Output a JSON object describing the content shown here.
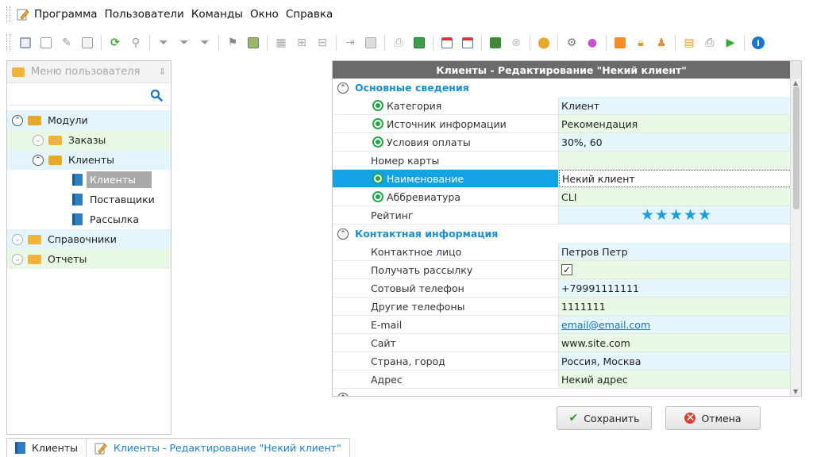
{
  "menubar": {
    "items": [
      "Программа",
      "Пользователи",
      "Команды",
      "Окно",
      "Справка"
    ]
  },
  "toolbar": {
    "icons": [
      "save-icon",
      "copy-icon",
      "edit-icon",
      "export-icon",
      "refresh-icon",
      "search-icon",
      "filter-icon",
      "filter-clear-icon",
      "filter-edit-icon",
      "flag-icon",
      "image-icon",
      "grid-icon",
      "expand-icon",
      "collapse-icon",
      "insert-column-icon",
      "note-icon",
      "print-preview-icon",
      "excel-icon",
      "add-window-icon",
      "close-window-icon",
      "exit-icon",
      "stop-icon",
      "location-icon",
      "settings-icon",
      "color-icon",
      "rss-icon",
      "lock-icon",
      "users-icon",
      "table-icon",
      "print-icon",
      "play-icon",
      "info-icon"
    ]
  },
  "left_panel": {
    "title": "Меню пользователя",
    "tree": [
      {
        "label": "Модули",
        "level": 0,
        "expanded": true
      },
      {
        "label": "Заказы",
        "level": 1,
        "expanded": false
      },
      {
        "label": "Клиенты",
        "level": 1,
        "expanded": true
      },
      {
        "label": "Клиенты",
        "level": 2,
        "selected": true
      },
      {
        "label": "Поставщики",
        "level": 2
      },
      {
        "label": "Рассылка",
        "level": 2
      },
      {
        "label": "Справочники",
        "level": 0,
        "expanded": false
      },
      {
        "label": "Отчеты",
        "level": 0,
        "expanded": false
      }
    ]
  },
  "editor": {
    "title": "Клиенты - Редактирование \"Некий клиент\"",
    "sections": [
      {
        "title": "Основные сведения",
        "rows": [
          {
            "name": "Категория",
            "value": "Клиент",
            "required": true
          },
          {
            "name": "Источник информации",
            "value": "Рекомендация",
            "required": true
          },
          {
            "name": "Условия оплаты",
            "value": "30%, 60",
            "required": true
          },
          {
            "name": "Номер карты",
            "value": "",
            "required": false
          },
          {
            "name": "Наименование",
            "value": "Некий клиент",
            "required": true,
            "active": true
          },
          {
            "name": "Аббревиатура",
            "value": "CLI",
            "required": true
          },
          {
            "name": "Рейтинг",
            "rating": 5,
            "required": false
          }
        ]
      },
      {
        "title": "Контактная информация",
        "rows": [
          {
            "name": "Контактное лицо",
            "value": "Петров Петр"
          },
          {
            "name": "Получать рассылку",
            "checked": true
          },
          {
            "name": "Сотовый телефон",
            "value": "+79991111111"
          },
          {
            "name": "Другие телефоны",
            "value": "1111111"
          },
          {
            "name": "E-mail",
            "value": "email@email.com",
            "link": true
          },
          {
            "name": "Сайт",
            "value": "www.site.com"
          },
          {
            "name": "Страна, город",
            "value": "Россия, Москва"
          },
          {
            "name": "Адрес",
            "value": "Некий адрес"
          }
        ]
      }
    ]
  },
  "buttons": {
    "save": "Сохранить",
    "cancel": "Отмена"
  },
  "tabs": [
    {
      "label": "Клиенты",
      "active": false
    },
    {
      "label": "Клиенты - Редактирование \"Некий клиент\"",
      "active": true
    }
  ],
  "colors": {
    "accent": "#13a2e6",
    "section": "#1a8fd0",
    "row_a": "#e4f5fb",
    "row_b": "#e9f8e4",
    "title_bar": "#6b6b6b"
  }
}
